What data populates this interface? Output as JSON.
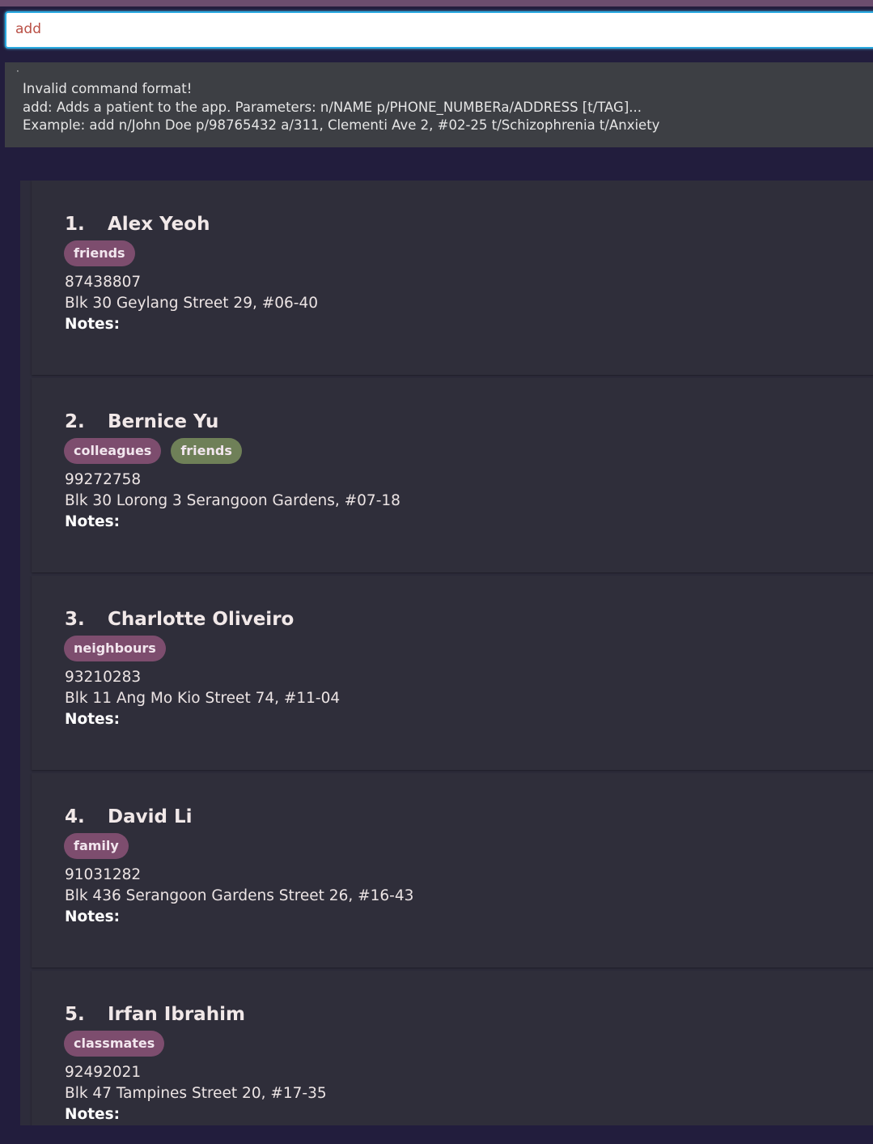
{
  "command": {
    "value": "add"
  },
  "result": {
    "marker": "·",
    "lines": [
      "Invalid command format!",
      "add: Adds a patient to the app. Parameters: n/NAME p/PHONE_NUMBERa/ADDRESS [t/TAG]...",
      "Example: add n/John Doe p/98765432 a/311, Clementi Ave 2, #02-25 t/Schizophrenia t/Anxiety"
    ]
  },
  "notes_label": "Notes:",
  "patients": [
    {
      "index": "1.",
      "name": "Alex Yeoh",
      "tags": [
        {
          "label": "friends",
          "color": "#7d4d6e"
        }
      ],
      "phone": "87438807",
      "address": "Blk 30 Geylang Street 29, #06-40"
    },
    {
      "index": "2.",
      "name": "Bernice Yu",
      "tags": [
        {
          "label": "colleagues",
          "color": "#7d4d6e"
        },
        {
          "label": "friends",
          "color": "#6f8058"
        }
      ],
      "phone": "99272758",
      "address": "Blk 30 Lorong 3 Serangoon Gardens, #07-18"
    },
    {
      "index": "3.",
      "name": "Charlotte Oliveiro",
      "tags": [
        {
          "label": "neighbours",
          "color": "#7d4d6e"
        }
      ],
      "phone": "93210283",
      "address": "Blk 11 Ang Mo Kio Street 74, #11-04"
    },
    {
      "index": "4.",
      "name": "David Li",
      "tags": [
        {
          "label": "family",
          "color": "#7d4d6e"
        }
      ],
      "phone": "91031282",
      "address": "Blk 436 Serangoon Gardens Street 26, #16-43"
    },
    {
      "index": "5.",
      "name": "Irfan Ibrahim",
      "tags": [
        {
          "label": "classmates",
          "color": "#7d4d6e"
        }
      ],
      "phone": "92492021",
      "address": "Blk 47 Tampines Street 20, #17-35"
    }
  ]
}
